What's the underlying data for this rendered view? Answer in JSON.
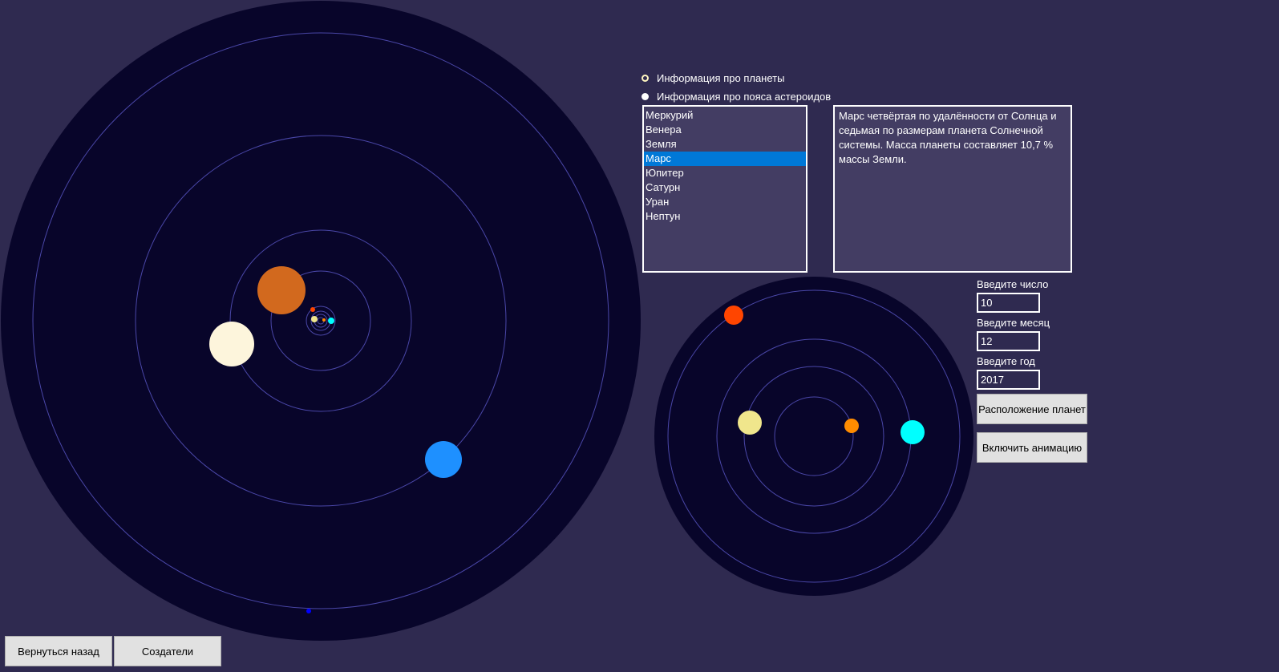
{
  "radio": {
    "planets_label": "Информация про планеты",
    "belts_label": "Информация про пояса астероидов",
    "selected": "planets"
  },
  "planet_list": {
    "items": [
      "Меркурий",
      "Венера",
      "Земля",
      "Марс",
      "Юпитер",
      "Сатурн",
      "Уран",
      "Нептун"
    ],
    "selected_index": 3
  },
  "info": {
    "text": "Марс четвёртая по удалённости от Солнца и седьмая по размерам планета Солнечной системы. Масса планеты составляет 10,7 % массы Земли."
  },
  "date_form": {
    "day_label": "Введите число",
    "day_value": "10",
    "month_label": "Введите месяц",
    "month_value": "12",
    "year_label": "Введите год",
    "year_value": "2017"
  },
  "buttons": {
    "positions": "Расположение планет",
    "animate": "Включить анимацию",
    "back": "Вернуться назад",
    "creators": "Создатели"
  },
  "colors": {
    "background": "#2f2a50",
    "space": "#08052a",
    "orbit": "#4a47a8",
    "selection": "#0078d7",
    "jupiter": "#d2691e",
    "saturn": "#fdf5dc",
    "uranus": "#1e90ff",
    "neptune": "#0000ff",
    "mercury": "#ff4500",
    "venus": "#f0e68c",
    "earth": "#00ffff",
    "mars": "#ff8c00"
  }
}
